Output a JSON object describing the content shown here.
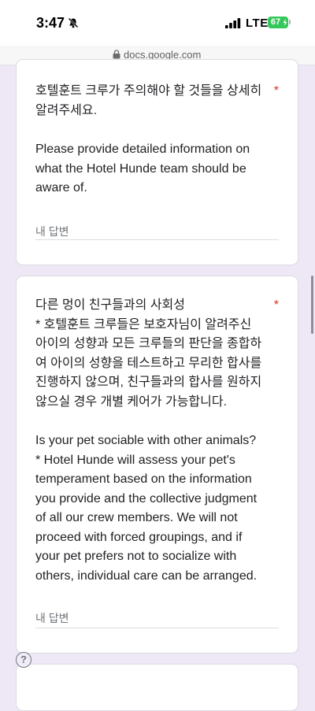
{
  "status_bar": {
    "time": "3:47",
    "network": "LTE",
    "battery": "67"
  },
  "browser": {
    "url": "docs.google.com"
  },
  "questions": [
    {
      "text_ko": "호텔훈트 크루가 주의해야 할 것들을 상세히 알려주세요.",
      "text_en": "Please provide detailed information on what the Hotel Hunde team should be aware of.",
      "required_mark": "*",
      "answer_placeholder": "내 답변"
    },
    {
      "text_ko": "다른 멍이 친구들과의 사회성\n* 호텔훈트 크루들은 보호자님이 알려주신 아이의 성향과 모든 크루들의 판단을 종합하여 아이의 성향을 테스트하고 무리한 합사를 진행하지 않으며, 친구들과의 합사를 원하지 않으실 경우 개별 케어가 가능합니다.",
      "text_en": "Is your pet sociable with other animals?\n* Hotel Hunde will assess your pet's temperament based on the information you provide and the collective judgment of all our crew members. We will not proceed with forced groupings, and if your pet prefers not to socialize with others, individual care can be arranged.",
      "required_mark": "*",
      "answer_placeholder": "내 답변"
    }
  ],
  "help": {
    "label": "?"
  },
  "colors": {
    "background": "#ede7f6",
    "required": "#d93025",
    "battery": "#34c759"
  }
}
